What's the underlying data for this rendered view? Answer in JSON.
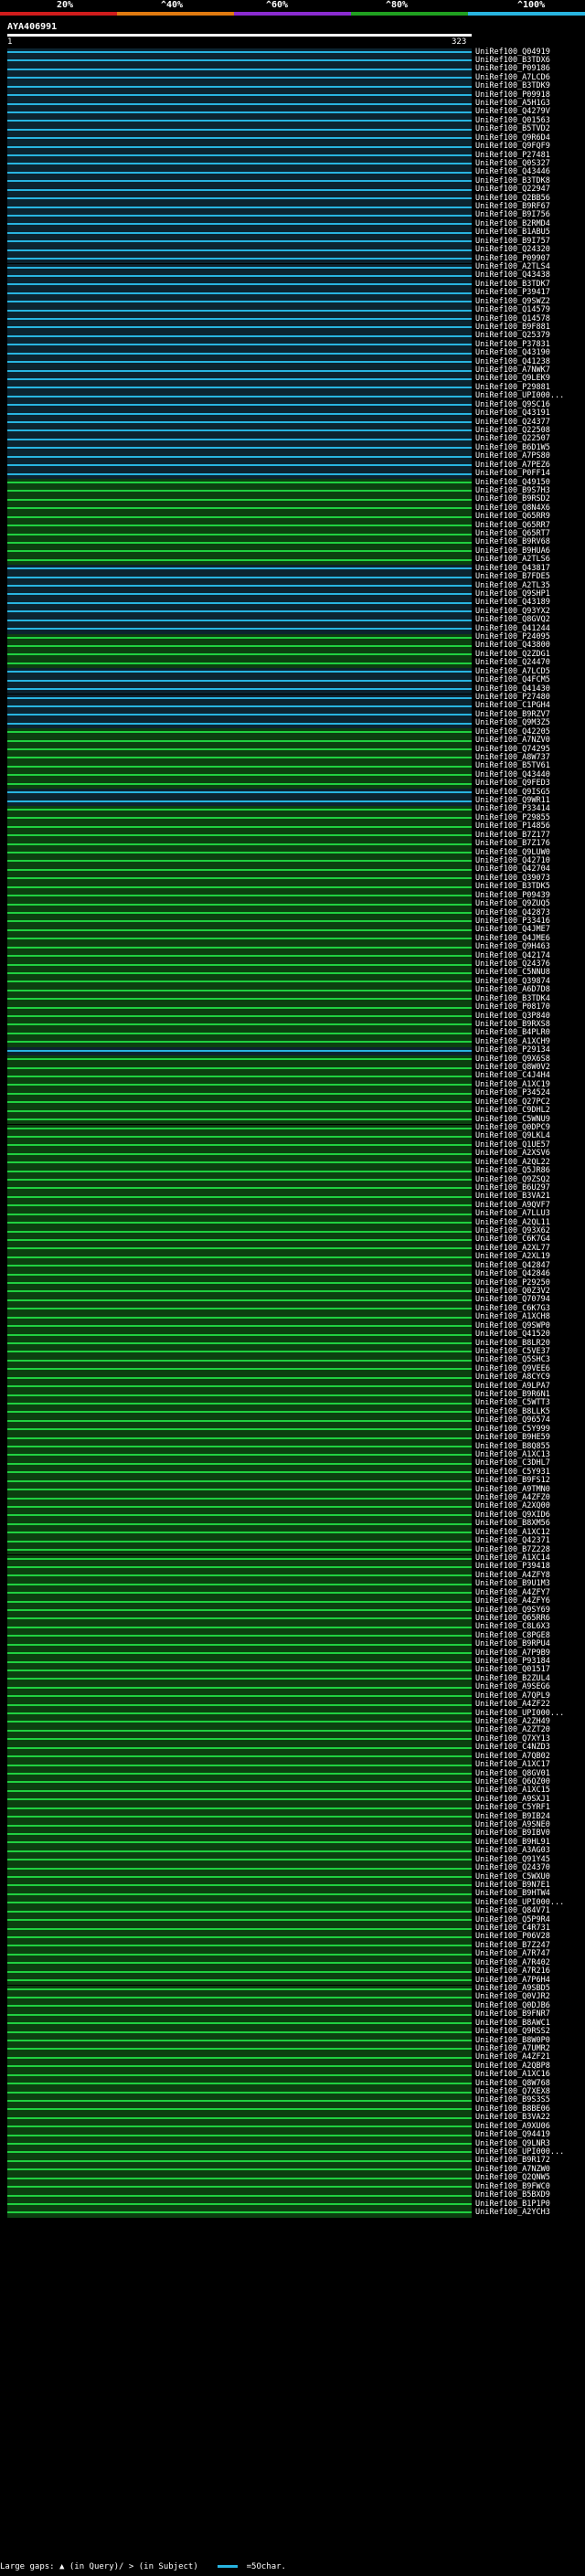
{
  "scale": {
    "labels": [
      "20%",
      "^40%",
      "^60%",
      "^80%",
      "^100%"
    ],
    "colors": [
      "#d01c1c",
      "#e07a10",
      "#8a2bd0",
      "#20a020",
      "#28b4e0"
    ]
  },
  "query": {
    "id": "AYA406991",
    "start": "1",
    "end": "323"
  },
  "colors": {
    "hit_line": "#20d040",
    "hit_bg": "#0c4010",
    "best_line": "#28b4e0",
    "best_bg": "#0c2430",
    "gap": "#000000",
    "frame": "#ffffff"
  },
  "hits": {
    "labels": [
      "UniRef100_Q04919",
      "UniRef100_B3TDX6",
      "UniRef100_P09186",
      "UniRef100_A7LCD6",
      "UniRef100_B3TDK9",
      "UniRef100_P09918",
      "UniRef100_A5H1G3",
      "UniRef100_Q4279V",
      "UniRef100_Q01563",
      "UniRef100_B5TVD2",
      "UniRef100_Q9R6D4",
      "UniRef100_Q9FQF9",
      "UniRef100_P27481",
      "UniRef100_Q0S327",
      "UniRef100_Q43446",
      "UniRef100_B3TDK8",
      "UniRef100_Q22947",
      "UniRef100_Q2BB56",
      "UniRef100_B9RF67",
      "UniRef100_B9I756",
      "UniRef100_B2RMD4",
      "UniRef100_B1ABU5",
      "UniRef100_B9I757",
      "UniRef100_Q24320",
      "UniRef100_P09907",
      "UniRef100_A2TLS4",
      "UniRef100_Q43438",
      "UniRef100_B3TDK7",
      "UniRef100_P39417",
      "UniRef100_Q9SWZ2",
      "UniRef100_Q14579",
      "UniRef100_Q14578",
      "UniRef100_B9F881",
      "UniRef100_Q25379",
      "UniRef100_P37831",
      "UniRef100_Q43190",
      "UniRef100_Q41238",
      "UniRef100_A7NWK7",
      "UniRef100_Q9LEK9",
      "UniRef100_P29881",
      "UniRef100_UPI000...",
      "UniRef100_Q9SC16",
      "UniRef100_Q43191",
      "UniRef100_Q24377",
      "UniRef100_Q22508",
      "UniRef100_Q22507",
      "UniRef100_B6D1W5",
      "UniRef100_A7PS80",
      "UniRef100_A7PEZ6",
      "UniRef100_P0FF14",
      "UniRef100_Q49150",
      "UniRef100_B9S7H3",
      "UniRef100_B9RSD2",
      "UniRef100_Q8N4X6",
      "UniRef100_Q65RR9",
      "UniRef100_Q65RR7",
      "UniRef100_Q65RT7",
      "UniRef100_B9RV68",
      "UniRef100_B9HUA6",
      "UniRef100_A2TLS6",
      "UniRef100_Q43817",
      "UniRef100_B7FDE5",
      "UniRef100_A2TL35",
      "UniRef100_Q9SHP1",
      "UniRef100_Q43189",
      "UniRef100_Q93YX2",
      "UniRef100_Q8GVQ2",
      "UniRef100_Q41244",
      "UniRef100_P24095",
      "UniRef100_Q43800",
      "UniRef100_Q2ZDG1",
      "UniRef100_Q24470",
      "UniRef100_A7LCD5",
      "UniRef100_Q4FCM5",
      "UniRef100_Q41430",
      "UniRef100_P27480",
      "UniRef100_C1PGH4",
      "UniRef100_B9RZV7",
      "UniRef100_Q9M3Z5",
      "UniRef100_Q42205",
      "UniRef100_A7NZV0",
      "UniRef100_Q74295",
      "UniRef100_A8W737",
      "UniRef100_B5TV61",
      "UniRef100_Q43440",
      "UniRef100_Q9FED3",
      "UniRef100_Q9ISG5",
      "UniRef100_Q9WR11",
      "UniRef100_P33414",
      "UniRef100_P29855",
      "UniRef100_P14856",
      "UniRef100_B7Z177",
      "UniRef100_B7Z176",
      "UniRef100_Q9LUW0",
      "UniRef100_Q42710",
      "UniRef100_Q42704",
      "UniRef100_Q39073",
      "UniRef100_B3TDK5",
      "UniRef100_P09439",
      "UniRef100_Q9ZUQ5",
      "UniRef100_Q42873",
      "UniRef100_P33416",
      "UniRef100_Q4JME7",
      "UniRef100_Q4JME6",
      "UniRef100_Q9H463",
      "UniRef100_Q42174",
      "UniRef100_Q24376",
      "UniRef100_C5NNU8",
      "UniRef100_Q39874",
      "UniRef100_A6D7D8",
      "UniRef100_B3TDK4",
      "UniRef100_P08170",
      "UniRef100_Q3P840",
      "UniRef100_B9RXS8",
      "UniRef100_B4PLR0",
      "UniRef100_A1XCH9",
      "UniRef100_P29134",
      "UniRef100_Q9X6S8",
      "UniRef100_Q8W0V2",
      "UniRef100_C4J4H4",
      "UniRef100_A1XC19",
      "UniRef100_P34524",
      "UniRef100_Q27PC2",
      "UniRef100_C9DHL2",
      "UniRef100_C5WNU9",
      "UniRef100_Q0DPC9",
      "UniRef100_Q9LKL4",
      "UniRef100_Q1UE57",
      "UniRef100_A2XSV6",
      "UniRef100_A2QL22",
      "UniRef100_Q5JR86",
      "UniRef100_Q9ZSQ2",
      "UniRef100_B6U297",
      "UniRef100_B3VA21",
      "UniRef100_A9QVF7",
      "UniRef100_A7LLU3",
      "UniRef100_A2QL11",
      "UniRef100_Q93X62",
      "UniRef100_C6K7G4",
      "UniRef100_A2XL77",
      "UniRef100_A2XL19",
      "UniRef100_Q42847",
      "UniRef100_Q42846",
      "UniRef100_P29250",
      "UniRef100_Q0Z3V2",
      "UniRef100_Q70794",
      "UniRef100_C6K7G3",
      "UniRef100_A1XCH8",
      "UniRef100_Q9SWP0",
      "UniRef100_Q41520",
      "UniRef100_B8LR20",
      "UniRef100_C5VE37",
      "UniRef100_Q5SHC3",
      "UniRef100_Q9VEE6",
      "UniRef100_A8CYC9",
      "UniRef100_A9LPA7",
      "UniRef100_B9R6N1",
      "UniRef100_C5WTT3",
      "UniRef100_B8LLK5",
      "UniRef100_Q96574",
      "UniRef100_C5Y999",
      "UniRef100_B9HE59",
      "UniRef100_B8Q855",
      "UniRef100_A1XC13",
      "UniRef100_C3DHL7",
      "UniRef100_C5Y931",
      "UniRef100_B9FS12",
      "UniRef100_A9TMN0",
      "UniRef100_A4ZFZ0",
      "UniRef100_A2XQ00",
      "UniRef100_Q9XID6",
      "UniRef100_B8XM56",
      "UniRef100_A1XC12",
      "UniRef100_Q42371",
      "UniRef100_B7Z228",
      "UniRef100_A1XC14",
      "UniRef100_P39418",
      "UniRef100_A4ZFY8",
      "UniRef100_B9U1M3",
      "UniRef100_A4ZFY7",
      "UniRef100_A4ZFY6",
      "UniRef100_Q9SY69",
      "UniRef100_Q65RR6",
      "UniRef100_C8L6X3",
      "UniRef100_C8PGE8",
      "UniRef100_B9RPU4",
      "UniRef100_A7P9B9",
      "UniRef100_P93184",
      "UniRef100_Q01517",
      "UniRef100_B2ZUL4",
      "UniRef100_A9SEG6",
      "UniRef100_A7QPL9",
      "UniRef100_A4ZF22",
      "UniRef100_UPI000...",
      "UniRef100_A2ZH49",
      "UniRef100_A2ZT20",
      "UniRef100_Q7XY13",
      "UniRef100_C4NZD3",
      "UniRef100_A7QB02",
      "UniRef100_A1XC17",
      "UniRef100_Q8GV01",
      "UniRef100_Q6QZ00",
      "UniRef100_A1XC15",
      "UniRef100_A9SXJ1",
      "UniRef100_C5YRF1",
      "UniRef100_B9IB24",
      "UniRef100_A9SNE0",
      "UniRef100_B9IBV0",
      "UniRef100_B9HL91",
      "UniRef100_A3AG03",
      "UniRef100_Q91Y45",
      "UniRef100_Q24370",
      "UniRef100_C5WXU0",
      "UniRef100_B9N7E1",
      "UniRef100_B9HTW4",
      "UniRef100_UPI000...",
      "UniRef100_Q84V71",
      "UniRef100_Q5P9R4",
      "UniRef100_C4R731",
      "UniRef100_P06V28",
      "UniRef100_B7Z247",
      "UniRef100_A7R747",
      "UniRef100_A7R402",
      "UniRef100_A7R216",
      "UniRef100_A7P6H4",
      "UniRef100_A9SBD5",
      "UniRef100_Q0VJR2",
      "UniRef100_Q0DJB6",
      "UniRef100_B9FNR7",
      "UniRef100_B8AWC1",
      "UniRef100_Q9RSS2",
      "UniRef100_B8W0P0",
      "UniRef100_A7UMR2",
      "UniRef100_A4ZF21",
      "UniRef100_A2QBP8",
      "UniRef100_A1XC16",
      "UniRef100_Q8W768",
      "UniRef100_Q7XEX8",
      "UniRef100_B9S3S5",
      "UniRef100_B8BE06",
      "UniRef100_B3VA22",
      "UniRef100_A9XU06",
      "UniRef100_Q94419",
      "UniRef100_Q9LNR3",
      "UniRef100_UPI000...",
      "UniRef100_B9R172",
      "UniRef100_A7NZW0",
      "UniRef100_Q2QNW5",
      "UniRef100_B9FWC0",
      "UniRef100_B5BXD9",
      "UniRef100_B1P1P0",
      "UniRef100_A2YCH3"
    ]
  },
  "footer": {
    "large_gaps": "Large gaps:",
    "in_query": "(in Query)/",
    "in_subject": "(in Subject)",
    "legend": "=5Ochar."
  }
}
